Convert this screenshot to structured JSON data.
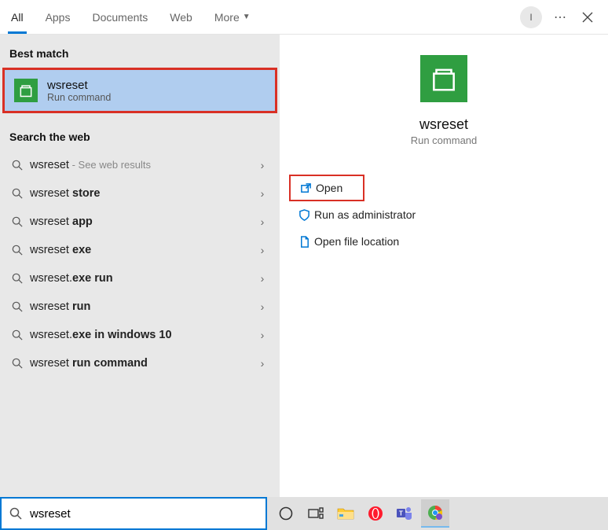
{
  "tabs": {
    "all": "All",
    "apps": "Apps",
    "documents": "Documents",
    "web": "Web",
    "more": "More"
  },
  "avatar_initial": "I",
  "sections": {
    "best_match": "Best match",
    "search_web": "Search the web"
  },
  "best_match": {
    "title": "wsreset",
    "subtitle": "Run command"
  },
  "web_results": [
    {
      "prefix": "wsreset",
      "suffix": "",
      "hint": " - See web results"
    },
    {
      "prefix": "wsreset ",
      "suffix": "store",
      "hint": ""
    },
    {
      "prefix": "wsreset ",
      "suffix": "app",
      "hint": ""
    },
    {
      "prefix": "wsreset ",
      "suffix": "exe",
      "hint": ""
    },
    {
      "prefix": "wsreset.",
      "suffix": "exe run",
      "hint": ""
    },
    {
      "prefix": "wsreset ",
      "suffix": "run",
      "hint": ""
    },
    {
      "prefix": "wsreset.",
      "suffix": "exe in windows 10",
      "hint": ""
    },
    {
      "prefix": "wsreset ",
      "suffix": "run command",
      "hint": ""
    }
  ],
  "preview": {
    "title": "wsreset",
    "subtitle": "Run command",
    "actions": {
      "open": "Open",
      "run_admin": "Run as administrator",
      "open_location": "Open file location"
    }
  },
  "search_value": "wsreset"
}
